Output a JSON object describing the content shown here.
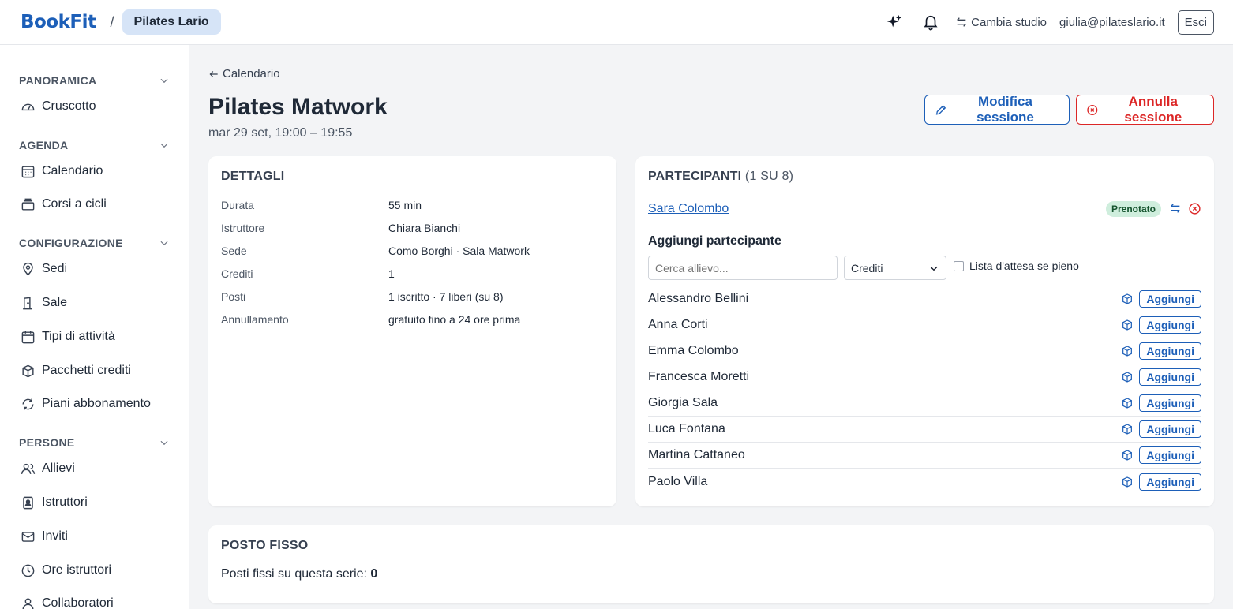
{
  "topbar": {
    "logo": "BookFit",
    "separator": "/",
    "studio": "Pilates Lario",
    "switch_label": "Cambia studio",
    "user_email": "giulia@pilateslario.it",
    "logout_label": "Esci",
    "icons": [
      "sparkles-icon",
      "bell-icon",
      "switch-arrows-icon"
    ]
  },
  "sidebar": {
    "groups": [
      {
        "label": "PANORAMICA",
        "items": [
          {
            "label": "Cruscotto",
            "icon": "gauge-icon"
          }
        ]
      },
      {
        "label": "AGENDA",
        "items": [
          {
            "label": "Calendario",
            "icon": "calendar-grid-icon"
          },
          {
            "label": "Corsi a cicli",
            "icon": "stack-icon"
          }
        ]
      },
      {
        "label": "CONFIGURAZIONE",
        "items": [
          {
            "label": "Sedi",
            "icon": "map-pin-icon"
          },
          {
            "label": "Sale",
            "icon": "door-icon"
          },
          {
            "label": "Tipi di attività",
            "icon": "calendar-icon"
          },
          {
            "label": "Pacchetti crediti",
            "icon": "package-icon"
          },
          {
            "label": "Piani abbonamento",
            "icon": "refresh-icon"
          }
        ]
      },
      {
        "label": "PERSONE",
        "items": [
          {
            "label": "Allievi",
            "icon": "users-icon"
          },
          {
            "label": "Istruttori",
            "icon": "badge-icon"
          },
          {
            "label": "Inviti",
            "icon": "mail-icon"
          },
          {
            "label": "Ore istruttori",
            "icon": "clock-icon"
          },
          {
            "label": "Collaboratori",
            "icon": "user-icon"
          }
        ]
      }
    ]
  },
  "page": {
    "back_label": "Calendario",
    "title": "Pilates Matwork",
    "subtitle": "mar 29 set, 19:00 – 19:55",
    "edit_label": "Modifica sessione",
    "cancel_label": "Annulla sessione"
  },
  "details": {
    "title": "DETTAGLI",
    "rows": [
      {
        "key": "Durata",
        "value": "55 min"
      },
      {
        "key": "Istruttore",
        "value": "Chiara Bianchi"
      },
      {
        "key": "Sede",
        "value": "Como Borghi · Sala Matwork"
      },
      {
        "key": "Crediti",
        "value": "1"
      },
      {
        "key": "Posti",
        "value": "1 iscritto · 7 liberi (su 8)"
      },
      {
        "key": "Annullamento",
        "value": "gratuito fino a 24 ore prima"
      }
    ]
  },
  "participants": {
    "title": "PARTECIPANTI",
    "count": "(1 SU 8)",
    "booked_name": "Sara Colombo",
    "booked_status": "Prenotato",
    "add_title": "Aggiungi partecipante",
    "search_placeholder": "Cerca allievo...",
    "payment_selected": "Crediti",
    "waitlist_label": "Lista d'attesa se pieno",
    "add_button": "Aggiungi",
    "candidates": [
      "Alessandro Bellini",
      "Anna Corti",
      "Emma Colombo",
      "Francesca Moretti",
      "Giorgia Sala",
      "Luca Fontana",
      "Martina Cattaneo",
      "Paolo Villa"
    ]
  },
  "fixed_seat": {
    "title": "POSTO FISSO",
    "text": "Posti fissi su questa serie:",
    "count": "0"
  },
  "colors": {
    "accent": "#1d5fb8",
    "danger": "#dc2626",
    "badge_bg": "#cfeedd",
    "chip_bg": "#d6e4f7"
  }
}
